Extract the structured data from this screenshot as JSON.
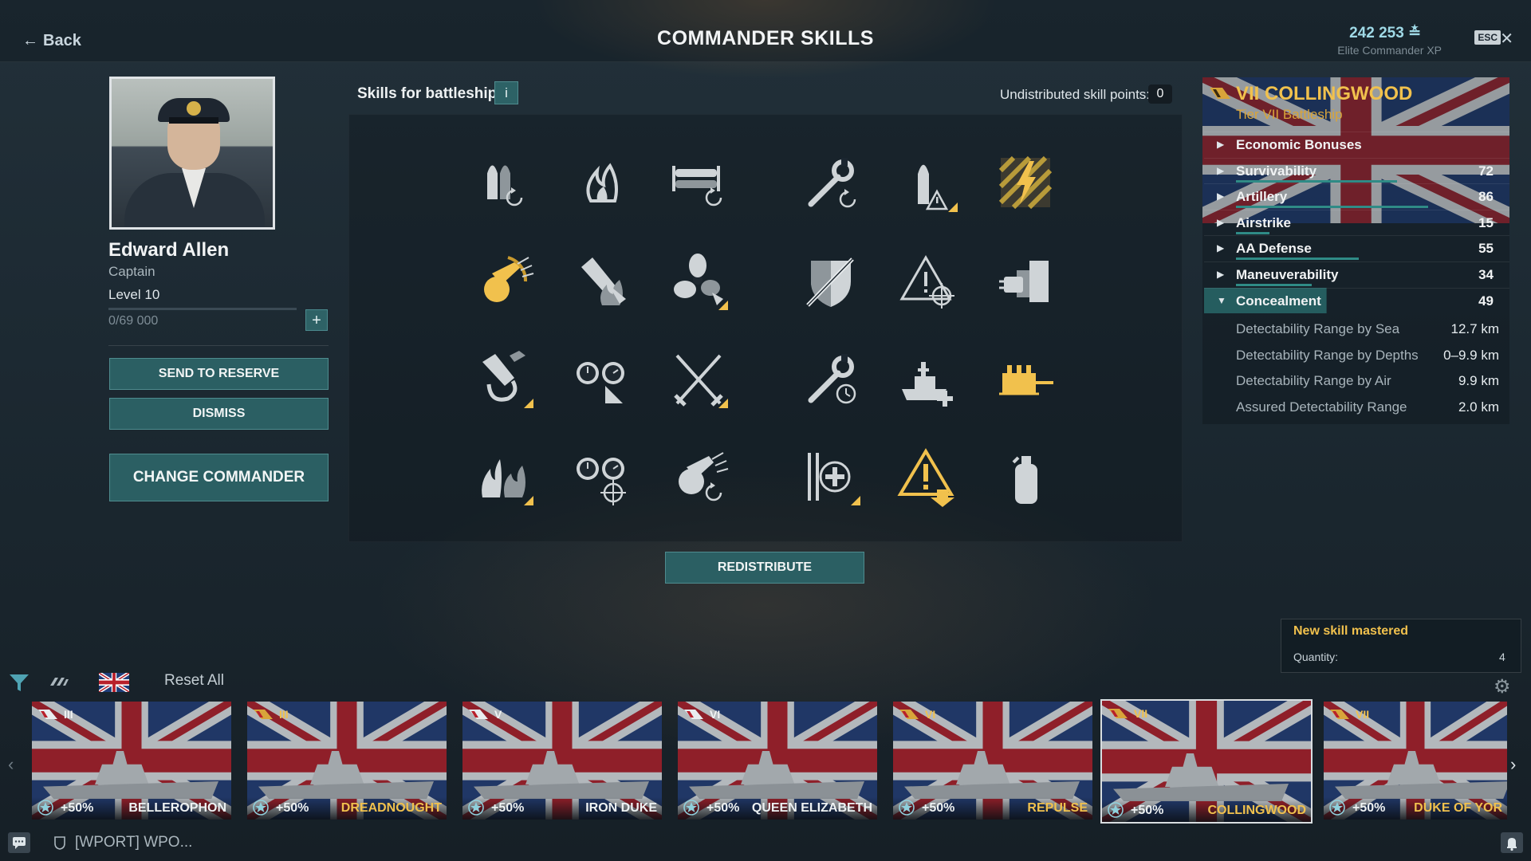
{
  "header": {
    "back_label": "Back",
    "title": "COMMANDER SKILLS",
    "elite_xp_value": "242 253",
    "elite_xp_label": "Elite Commander XP",
    "esc_label": "ESC"
  },
  "commander": {
    "name": "Edward Allen",
    "rank": "Captain",
    "level": "Level 10",
    "xp_progress": "0/69 000",
    "xp_fraction": 0.0,
    "send_to_reserve_label": "SEND TO RESERVE",
    "dismiss_label": "DISMISS",
    "change_commander_label": "CHANGE COMMANDER"
  },
  "skills": {
    "title": "Skills for battleships",
    "info_label": "i",
    "undistributed_label": "Undistributed skill points:",
    "undistributed_value": "0",
    "redistribute_label": "REDISTRIBUTE",
    "grid": [
      [
        "shells-reload-icon",
        "fire-icon",
        "torpedo-reload-icon",
        "wrench-reload-icon",
        "shell-warning-icon",
        "lightning-hazard-icon"
      ],
      [
        "shell-burst-icon",
        "shell-fire-icon",
        "propeller-icon",
        "shield-sword-icon",
        "warning-crosshair-icon",
        "secondary-guns-icon"
      ],
      [
        "shell-spiral-icon",
        "gauges-icon",
        "crossed-swords-icon",
        "wrench-timer-icon",
        "battleship-plus-icon",
        "aa-guns-icon"
      ],
      [
        "fire-split-icon",
        "gauges-crosshair-icon",
        "shell-splash-reload-icon",
        "repair-plus-icon",
        "warning-down-icon",
        "extinguisher-icon"
      ]
    ]
  },
  "ship": {
    "name": "VII COLLINGWOOD",
    "type": "Tier VII Battleship",
    "categories": [
      {
        "label": "Economic Bonuses",
        "value": "",
        "fill": 0
      },
      {
        "label": "Survivability",
        "value": "72",
        "fill": 0.72
      },
      {
        "label": "Artillery",
        "value": "86",
        "fill": 0.86
      },
      {
        "label": "Airstrike",
        "value": "15",
        "fill": 0.15
      },
      {
        "label": "AA Defense",
        "value": "55",
        "fill": 0.55
      },
      {
        "label": "Maneuverability",
        "value": "34",
        "fill": 0.34
      },
      {
        "label": "Concealment",
        "value": "49",
        "fill": 0.49
      }
    ],
    "details": [
      {
        "label": "Detectability Range by Sea",
        "value": "12.7 km"
      },
      {
        "label": "Detectability Range by Depths",
        "value": "0–9.9 km"
      },
      {
        "label": "Detectability Range by Air",
        "value": "9.9 km"
      },
      {
        "label": "Assured Detectability Range",
        "value": "2.0 km"
      }
    ]
  },
  "notification": {
    "title": "New skill mastered",
    "quantity_label": "Quantity:",
    "quantity_value": "4"
  },
  "filters": {
    "reset_label": "Reset All"
  },
  "carousel": [
    {
      "tier": "III",
      "bonus": "+50%",
      "name": "BELLEROPHON",
      "premium": false
    },
    {
      "tier": "III",
      "bonus": "+50%",
      "name": "DREADNOUGHT",
      "premium": true
    },
    {
      "tier": "V",
      "bonus": "+50%",
      "name": "IRON DUKE",
      "premium": false
    },
    {
      "tier": "VI",
      "bonus": "+50%",
      "name": "QUEEN ELIZABETH",
      "premium": false
    },
    {
      "tier": "VI",
      "bonus": "+50%",
      "name": "REPULSE",
      "premium": true
    },
    {
      "tier": "VII",
      "bonus": "+50%",
      "name": "COLLINGWOOD",
      "premium": true
    },
    {
      "tier": "VII",
      "bonus": "+50%",
      "name": "DUKE OF YOR",
      "premium": true
    }
  ],
  "bottom": {
    "clan_text": "[WPORT] WPO..."
  },
  "colors": {
    "accent_teal": "#2b5f63",
    "gold": "#f1c14d",
    "stat_bar": "#2f8b86"
  }
}
